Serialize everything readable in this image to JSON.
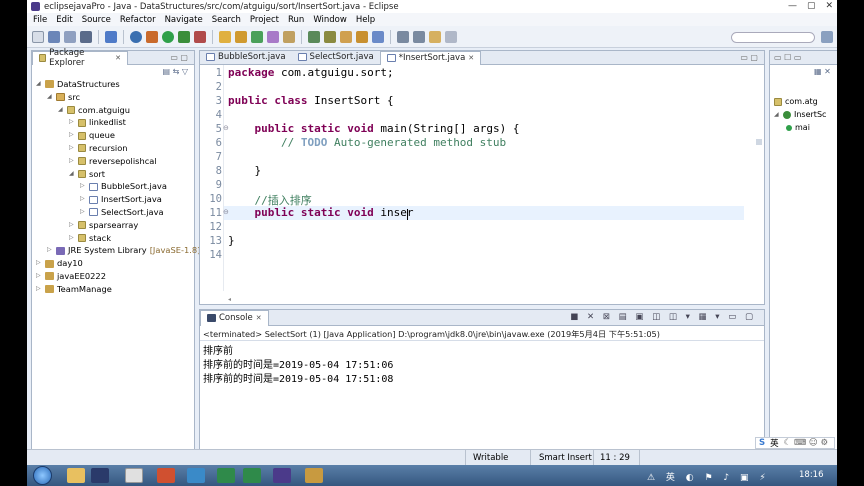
{
  "window": {
    "title": "eclipsejavaPro - Java - DataStructures/src/com/atguigu/sort/InsertSort.java - Eclipse",
    "controls": [
      "—",
      "▢",
      "✕"
    ]
  },
  "menu": [
    "File",
    "Edit",
    "Source",
    "Refactor",
    "Navigate",
    "Search",
    "Project",
    "Run",
    "Window",
    "Help"
  ],
  "package_explorer": {
    "tab_label": "Package Explorer",
    "tree": [
      {
        "label": "DataStructures",
        "icon": "project-icon",
        "level": 0,
        "arrow": "◢"
      },
      {
        "label": "src",
        "icon": "source-folder-icon",
        "level": 1,
        "arrow": "◢"
      },
      {
        "label": "com.atguigu",
        "icon": "package-icon",
        "level": 2,
        "arrow": "◢"
      },
      {
        "label": "linkedlist",
        "icon": "package-icon",
        "level": 3,
        "arrow": "▷"
      },
      {
        "label": "queue",
        "icon": "package-icon",
        "level": 3,
        "arrow": "▷"
      },
      {
        "label": "recursion",
        "icon": "package-icon",
        "level": 3,
        "arrow": "▷"
      },
      {
        "label": "reversepolishcal",
        "icon": "package-icon",
        "level": 3,
        "arrow": "▷"
      },
      {
        "label": "sort",
        "icon": "package-icon",
        "level": 3,
        "arrow": "◢"
      },
      {
        "label": "BubbleSort.java",
        "icon": "java-file-icon",
        "level": 4,
        "arrow": "▷"
      },
      {
        "label": "InsertSort.java",
        "icon": "java-file-icon",
        "level": 4,
        "arrow": "▷"
      },
      {
        "label": "SelectSort.java",
        "icon": "java-file-icon",
        "level": 4,
        "arrow": "▷"
      },
      {
        "label": "sparsearray",
        "icon": "package-icon",
        "level": 3,
        "arrow": "▷"
      },
      {
        "label": "stack",
        "icon": "package-icon",
        "level": 3,
        "arrow": "▷"
      },
      {
        "label": "JRE System Library",
        "suffix": "[JavaSE-1.8]",
        "icon": "library-icon",
        "level": 1,
        "arrow": "▷"
      },
      {
        "label": "day10",
        "icon": "project-icon",
        "level": 0,
        "arrow": "▷"
      },
      {
        "label": "javaEE0222",
        "icon": "project-icon",
        "level": 0,
        "arrow": "▷"
      },
      {
        "label": "TeamManage",
        "icon": "project-icon",
        "level": 0,
        "arrow": "▷"
      }
    ]
  },
  "editor": {
    "tabs": [
      {
        "label": "BubbleSort.java",
        "active": false
      },
      {
        "label": "SelectSort.java",
        "active": false
      },
      {
        "label": "*InsertSort.java",
        "active": true
      }
    ],
    "line_numbers": [
      "1",
      "2",
      "3",
      "4",
      "5",
      "6",
      "7",
      "8",
      "9",
      "10",
      "11",
      "12",
      "13",
      "14"
    ],
    "lines": [
      [
        {
          "t": "package",
          "k": "kw"
        },
        {
          "t": " com.atguigu.sort;"
        }
      ],
      [],
      [
        {
          "t": "public",
          "k": "kw"
        },
        {
          "t": " "
        },
        {
          "t": "class",
          "k": "kw"
        },
        {
          "t": " InsertSort {"
        }
      ],
      [],
      [
        {
          "t": "    "
        },
        {
          "t": "public",
          "k": "kw"
        },
        {
          "t": " "
        },
        {
          "t": "static",
          "k": "kw"
        },
        {
          "t": " "
        },
        {
          "t": "void",
          "k": "kw"
        },
        {
          "t": " main(String[] args) {"
        }
      ],
      [
        {
          "t": "        "
        },
        {
          "t": "// ",
          "k": "cm"
        },
        {
          "t": "TODO",
          "k": "todo"
        },
        {
          "t": " Auto-generated method stub",
          "k": "cm"
        }
      ],
      [],
      [
        {
          "t": "    }"
        }
      ],
      [],
      [
        {
          "t": "    "
        },
        {
          "t": "//插入排序",
          "k": "cm"
        }
      ],
      [
        {
          "t": "    "
        },
        {
          "t": "public",
          "k": "kw"
        },
        {
          "t": " "
        },
        {
          "t": "static",
          "k": "kw"
        },
        {
          "t": " "
        },
        {
          "t": "void",
          "k": "kw"
        },
        {
          "t": " inser"
        }
      ],
      [],
      [
        {
          "t": "}"
        }
      ],
      []
    ]
  },
  "outline": {
    "items": [
      "com.atg",
      "InsertSc",
      "mai"
    ]
  },
  "console": {
    "tab_label": "Console",
    "header": "<terminated> SelectSort (1) [Java Application] D:\\program\\jdk8.0\\jre\\bin\\javaw.exe (2019年5月4日 下午5:51:05)",
    "lines": [
      "排序前",
      "排序前的时间是=2019-05-04 17:51:06",
      "排序前的时间是=2019-05-04 17:51:08"
    ]
  },
  "status": {
    "writable": "Writable",
    "insert_mode": "Smart Insert",
    "position": "11 : 29"
  },
  "taskbar": {
    "clock": "18:16",
    "ime": "英"
  },
  "colors": {
    "keyword": "#7f0055",
    "comment": "#3f7f5f",
    "todo": "#7f9fbf",
    "current_line": "#e8f2fe"
  }
}
